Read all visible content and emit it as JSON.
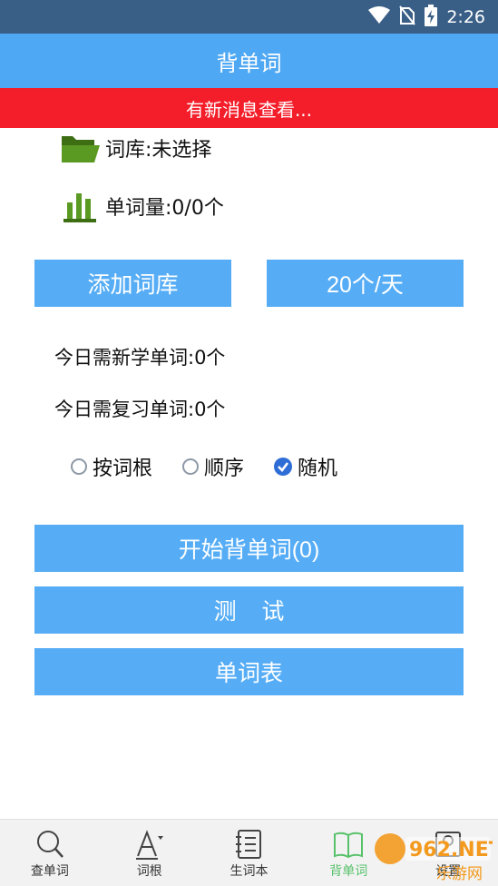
{
  "status_bar": {
    "time": "2:26"
  },
  "app_bar": {
    "title": "背单词"
  },
  "notice": {
    "text": "有新消息查看..."
  },
  "info": {
    "library": "词库:未选择",
    "word_count": "单词量:0/0个"
  },
  "buttons": {
    "add_library": "添加词库",
    "per_day": "20个/天",
    "start": "开始背单词(0)",
    "test": "测    试",
    "word_list": "单词表"
  },
  "stats": {
    "new_today": "今日需新学单词:0个",
    "review_today": "今日需复习单词:0个"
  },
  "order_options": [
    {
      "label": "按词根",
      "checked": false
    },
    {
      "label": "顺序",
      "checked": false
    },
    {
      "label": "随机",
      "checked": true
    }
  ],
  "tabs": [
    {
      "label": "查单词",
      "icon": "search-icon",
      "active": false
    },
    {
      "label": "词根",
      "icon": "letter-a-icon",
      "active": false
    },
    {
      "label": "生词本",
      "icon": "notebook-icon",
      "active": false
    },
    {
      "label": "背单词",
      "icon": "open-book-icon",
      "active": true
    },
    {
      "label": "设置",
      "icon": "settings-icon",
      "active": false
    }
  ],
  "watermark": {
    "text": "962.NET",
    "subtext": "乐游网"
  },
  "colors": {
    "status_bar": "#3a5f86",
    "app_bar": "#4fa8f3",
    "notice": "#f41e2a",
    "button": "#56adf6",
    "active_tab": "#57c26a",
    "icon_green": "#4f8a1f"
  }
}
